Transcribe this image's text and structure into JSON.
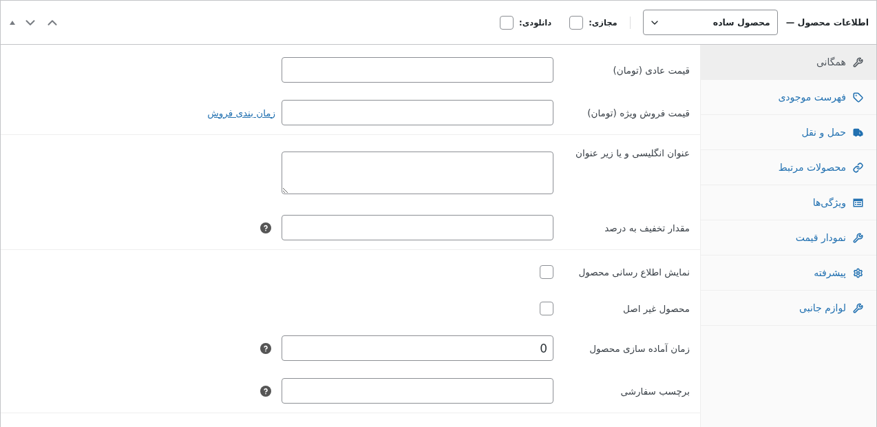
{
  "header": {
    "title": "اطلاعات محصول —",
    "product_type": {
      "value": "محصول ساده"
    },
    "options": [
      {
        "label": "مجازی:",
        "checked": false
      },
      {
        "label": "دانلودی:",
        "checked": false
      }
    ]
  },
  "tabs": [
    {
      "label": "همگانی",
      "kind": "wrench",
      "selected": true
    },
    {
      "label": "فهرست موجودی",
      "kind": "tag",
      "selected": false
    },
    {
      "label": "حمل و نقل",
      "kind": "truck",
      "selected": false
    },
    {
      "label": "محصولات مرتبط",
      "kind": "link",
      "selected": false
    },
    {
      "label": "ویژگی‌ها",
      "kind": "list",
      "selected": false
    },
    {
      "label": "نمودار قیمت",
      "kind": "wrench",
      "selected": false
    },
    {
      "label": "پیشرفته",
      "kind": "gear",
      "selected": false
    },
    {
      "label": "لوازم جانبی",
      "kind": "wrench",
      "selected": false
    }
  ],
  "groups": [
    {
      "fields": [
        {
          "kind": "text",
          "label": "قیمت عادی (تومان)"
        },
        {
          "kind": "text",
          "label": "قیمت فروش ویژه (تومان)",
          "link": "زمان بندی فروش"
        }
      ]
    },
    {
      "fields": [
        {
          "kind": "textarea",
          "label": "عنوان انگلیسی و یا زیر عنوان"
        },
        {
          "kind": "text",
          "label": "مقدار تخفیف به درصد",
          "help": true
        }
      ]
    },
    {
      "fields": [
        {
          "kind": "checkbox",
          "label": "نمایش اطلاع رسانی محصول",
          "checked": false
        },
        {
          "kind": "checkbox",
          "label": "محصول غیر اصل",
          "checked": false
        },
        {
          "kind": "text",
          "label": "زمان آماده سازی محصول",
          "value": "0",
          "help": true
        },
        {
          "kind": "text",
          "label": "برچسب سفارشی",
          "help": true
        }
      ]
    }
  ]
}
